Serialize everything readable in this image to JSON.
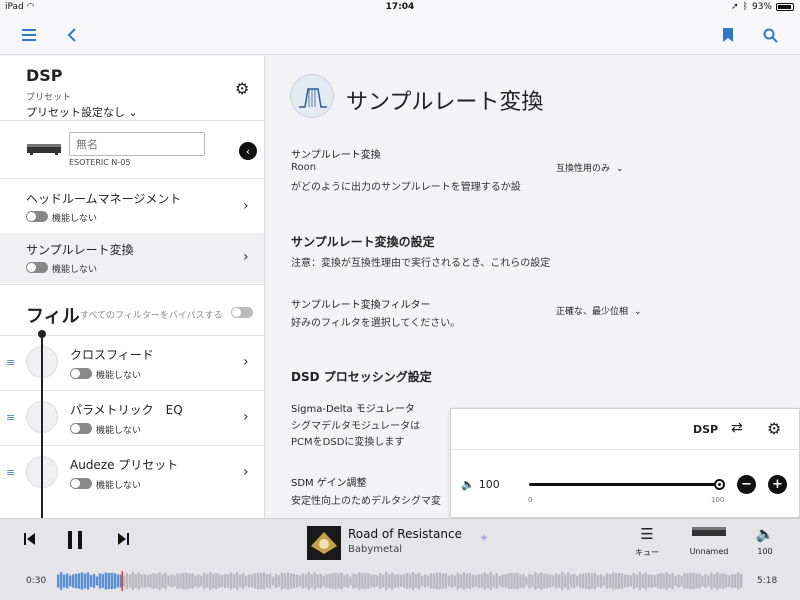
{
  "status_bar": {
    "device": "iPad",
    "time": "17:04",
    "battery": "93%"
  },
  "toolbar": {},
  "left": {
    "title": "DSP",
    "preset_label": "プリセット",
    "preset_value": "プリセット設定なし",
    "name_placeholder": "無名",
    "device_name": "ESOTERIC N-05",
    "rows": [
      {
        "title": "ヘッドルームマネージメント",
        "state": "機能しない"
      },
      {
        "title": "サンプルレート変換",
        "state": "機能しない"
      }
    ],
    "filter_header": "フィル",
    "bypass_label": "すべてのフィルターをバイパスする",
    "filters": [
      {
        "title": "クロスフィード",
        "state": "機能しない"
      },
      {
        "title": "パラメトリック　EQ",
        "state": "機能しない"
      },
      {
        "title": "Audeze プリセット",
        "state": "機能しない"
      }
    ]
  },
  "main": {
    "title": "サンプルレート変換",
    "src_label": "サンプルレート変換",
    "src_desc_1": "Roon",
    "src_desc_2": "がどのように出力のサンプルレートを管理するか設",
    "src_select": "互換性用のみ",
    "settings_heading": "サンプルレート変換の設定",
    "settings_note": "注意：変換が互換性理由で実行されるとき、これらの設定",
    "filter_label": "サンプルレート変換フィルター",
    "filter_desc": "好みのフィルタを選択してください。",
    "filter_select": "正確な、最少位相",
    "dsd_heading": "DSD プロセッシング設定",
    "sigma_label": "Sigma-Delta モジュレータ",
    "sigma_desc_1": "シグマデルタモジュレータは",
    "sigma_desc_2": "PCMをDSDに変換します",
    "sdm_label": "SDM ゲイン調整",
    "sdm_desc": "安定性向上のためデルタシグマ変"
  },
  "popup": {
    "dsp_label": "DSP",
    "volume": "100",
    "min": "0",
    "max": "100",
    "level": 1.0
  },
  "player": {
    "track_title": "Road of Resistance",
    "artist": "Babymetal",
    "queue_label": "キュー",
    "zone_label": "Unnamed",
    "volume_label": "100",
    "elapsed": "0:30",
    "duration": "5:18",
    "progress": 0.094
  },
  "colors": {
    "accent": "#2f7ac4",
    "waveform_played": "#5a8fd8",
    "waveform_rest": "#b9b9bf",
    "playhead": "#e04040"
  }
}
